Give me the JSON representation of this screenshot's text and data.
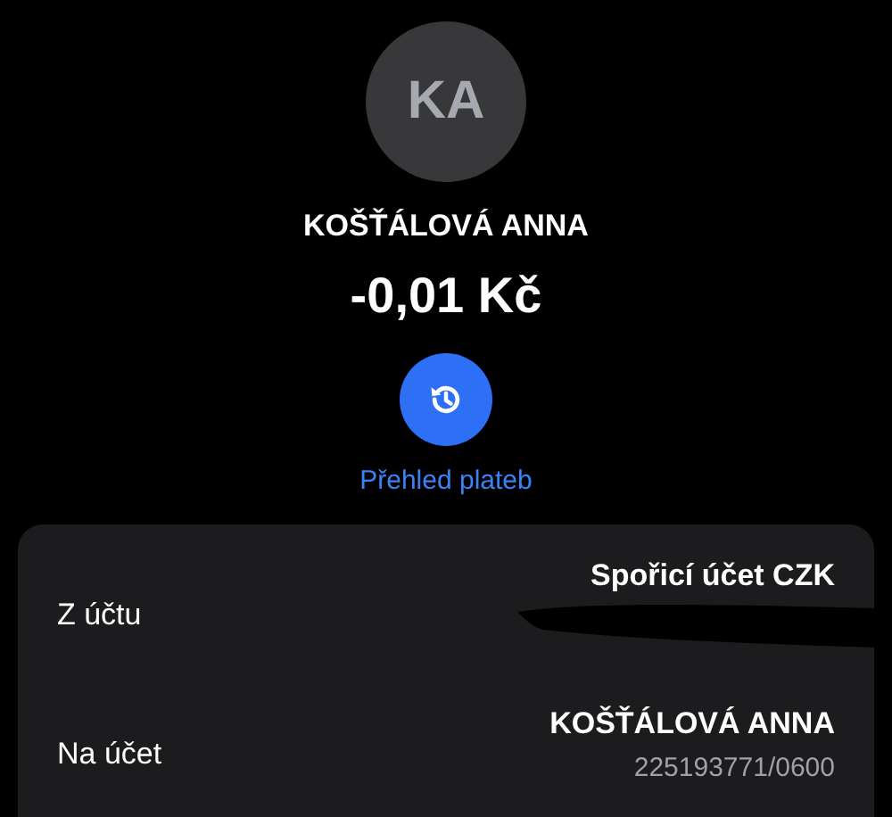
{
  "avatar": {
    "initials": "KA"
  },
  "name": "KOŠŤÁLOVÁ ANNA",
  "amount": "-0,01 Kč",
  "history_link": {
    "label": "Přehled plateb"
  },
  "details": [
    {
      "label": "Z účtu",
      "value": "Spořicí účet CZK",
      "redacted": true
    },
    {
      "label": "Na účet",
      "value": "KOŠŤÁLOVÁ ANNA",
      "detail": "225193771/0600",
      "redacted": false
    }
  ]
}
